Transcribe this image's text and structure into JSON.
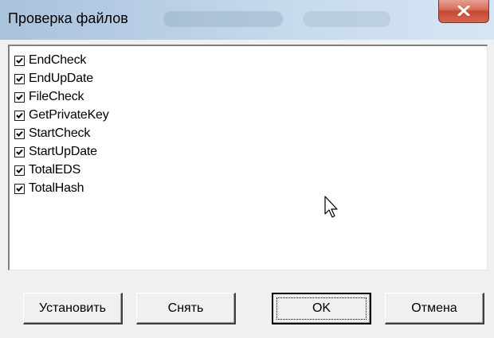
{
  "window": {
    "title": "Проверка файлов",
    "close_icon": "close-icon"
  },
  "file_list": {
    "items": [
      {
        "label": "EndCheck",
        "checked": true
      },
      {
        "label": "EndUpDate",
        "checked": true
      },
      {
        "label": "FileCheck",
        "checked": true
      },
      {
        "label": "GetPrivateKey",
        "checked": true
      },
      {
        "label": "StartCheck",
        "checked": true
      },
      {
        "label": "StartUpDate",
        "checked": true
      },
      {
        "label": "TotalEDS",
        "checked": true
      },
      {
        "label": "TotalHash",
        "checked": true
      }
    ]
  },
  "buttons": {
    "set_label": "Установить",
    "clear_label": "Снять",
    "ok_label": "OK",
    "cancel_label": "Отмена"
  },
  "colors": {
    "titlebar": "#b9d0e6",
    "close_button": "#c54a33",
    "face": "#f0f0f0"
  }
}
